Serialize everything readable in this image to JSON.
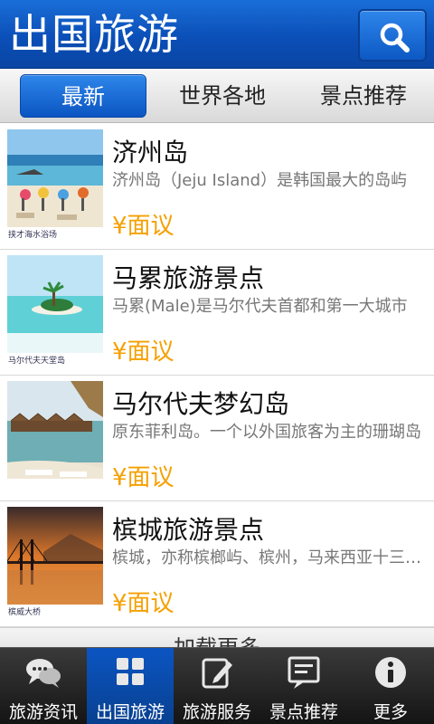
{
  "header": {
    "title": "出国旅游",
    "search_icon": "search-icon"
  },
  "tabs": [
    {
      "label": "最新",
      "active": true
    },
    {
      "label": "世界各地",
      "active": false
    },
    {
      "label": "景点推荐",
      "active": false
    }
  ],
  "items": [
    {
      "title": "济州岛",
      "desc": "济州岛（Jeju Island）是韩国最大的岛屿",
      "price": "¥面议",
      "caption": "挟才海水浴场"
    },
    {
      "title": "马累旅游景点",
      "desc": "马累(Male)是马尔代夫首都和第一大城市",
      "price": "¥面议",
      "caption": "马尔代夫天堂岛"
    },
    {
      "title": "马尔代夫梦幻岛",
      "desc": "原东菲利岛。一个以外国旅客为主的珊瑚岛",
      "price": "¥面议",
      "caption": ""
    },
    {
      "title": "槟城旅游景点",
      "desc": "槟城，亦称槟榔屿、槟州，马来西亚十三州之一",
      "price": "¥面议",
      "caption": "槟威大桥"
    }
  ],
  "load_more": "加载更多",
  "bottom_nav": [
    {
      "label": "旅游资讯",
      "icon": "chat-bubbles-icon",
      "active": false
    },
    {
      "label": "出国旅游",
      "icon": "grid-icon",
      "active": true
    },
    {
      "label": "旅游服务",
      "icon": "edit-icon",
      "active": false
    },
    {
      "label": "景点推荐",
      "icon": "comment-icon",
      "active": false
    },
    {
      "label": "更多",
      "icon": "info-icon",
      "active": false
    }
  ],
  "colors": {
    "header_blue": "#0b4fb8",
    "price_orange": "#f5a000",
    "nav_dark": "#1a1a1a"
  }
}
